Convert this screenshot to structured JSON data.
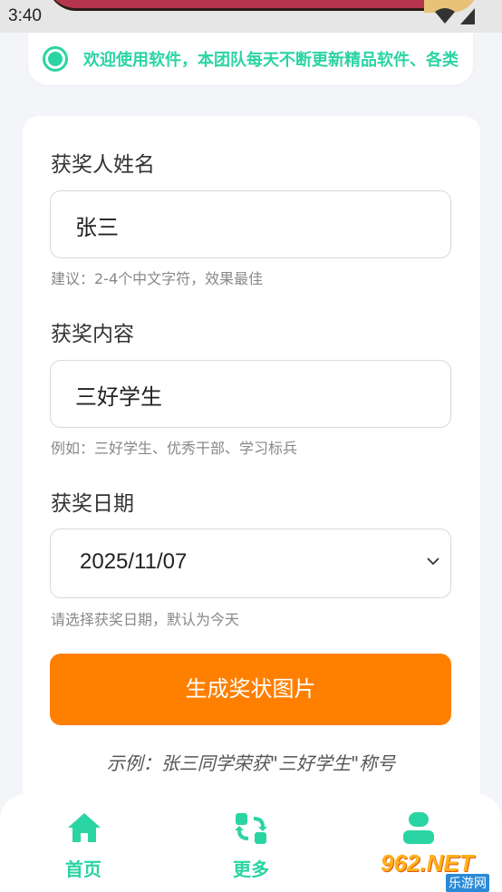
{
  "status_bar": {
    "time": "3:40",
    "icons": [
      "wifi-icon",
      "cell-signal-icon",
      "battery-icon"
    ]
  },
  "notice": {
    "icon": "radio-dot-icon",
    "text": "欢迎使用软件，本团队每天不断更新精品软件、各类"
  },
  "form": {
    "name_label": "获奖人姓名",
    "name_value": "张三",
    "name_hint": "建议：2-4个中文字符，效果最佳",
    "content_label": "获奖内容",
    "content_value": "三好学生",
    "content_hint": "例如：三好学生、优秀干部、学习标兵",
    "date_label": "获奖日期",
    "date_value": "2025/11/07",
    "date_hint": "请选择获奖日期，默认为今天",
    "generate_button": "生成奖状图片",
    "example": "示例：张三同学荣获\"三好学生\"称号"
  },
  "tabbar": {
    "items": [
      {
        "label": "首页",
        "icon": "home-icon"
      },
      {
        "label": "更多",
        "icon": "refresh-grid-icon"
      },
      {
        "label": "",
        "icon": "user-icon"
      }
    ]
  },
  "watermark": {
    "brand": "962.NET",
    "sub": "乐游网"
  },
  "colors": {
    "accent": "#2bd4a3",
    "button": "#ff7f00",
    "background": "#f4f5f9"
  }
}
